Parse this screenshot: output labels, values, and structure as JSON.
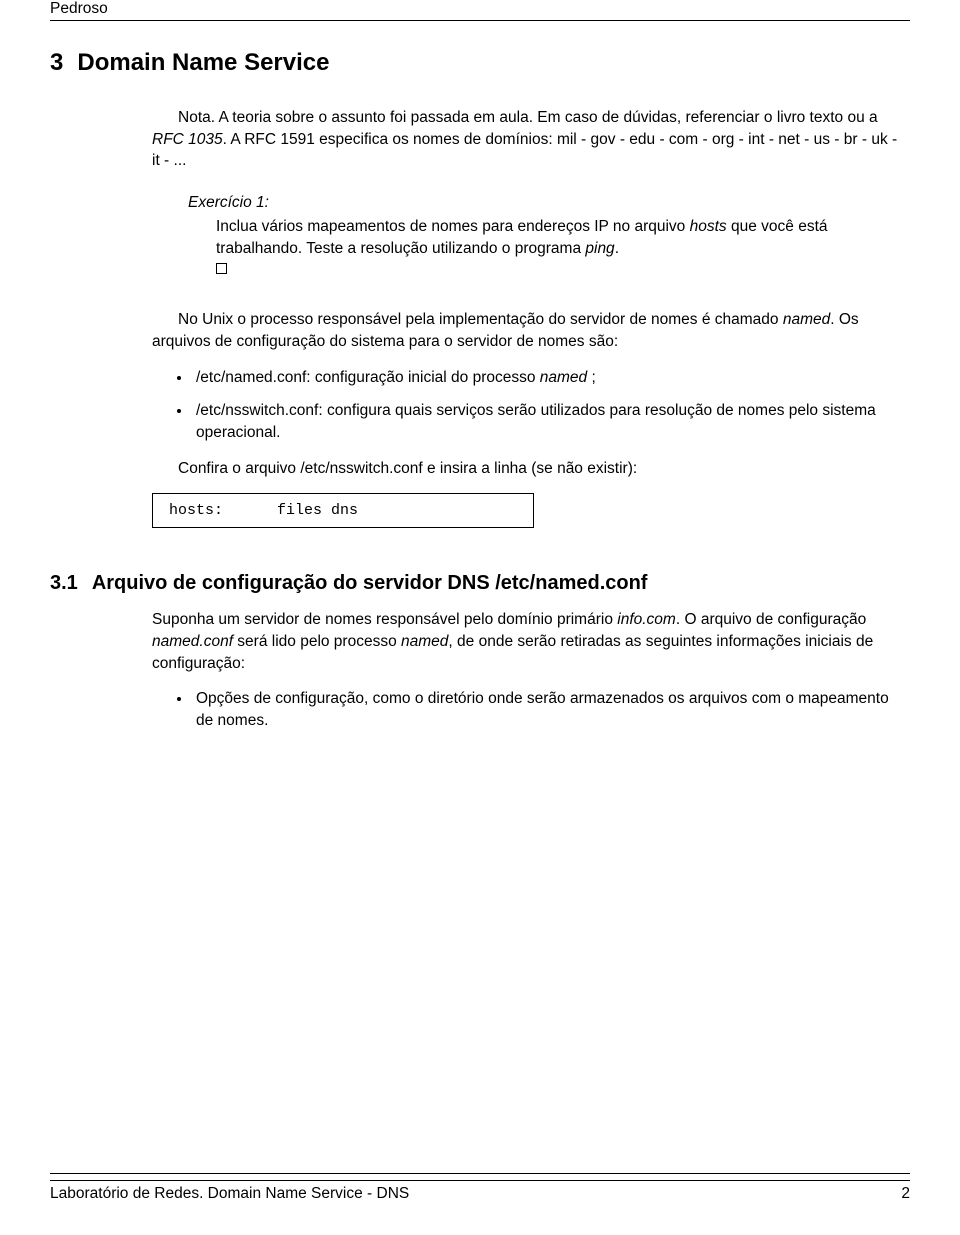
{
  "header": {
    "text": "Pedroso"
  },
  "section3": {
    "number": "3",
    "title": "Domain Name Service",
    "note_p1_a": "Nota. A teoria sobre o assunto foi passada em aula. Em caso de dúvidas, referenciar o livro texto ou a ",
    "note_p1_b": "RFC 1035",
    "note_p1_c": ". A RFC 1591 especifica os nomes de domínios: mil - gov - edu - com - org - int - net - us - br - uk - it - ...",
    "exercise_title": "Exercício 1:",
    "exercise_body_a": "Inclua vários mapeamentos de nomes para endereços IP no arquivo ",
    "exercise_body_b": "hosts",
    "exercise_body_c": " que você está trabalhando. Teste a resolução utilizando o programa ",
    "exercise_body_d": "ping",
    "exercise_body_e": ".",
    "p2_a": "No Unix o processo responsável pela implementação do servidor de nomes é chamado ",
    "p2_b": "named",
    "p2_c": ". Os arquivos de configuração do sistema para o servidor de nomes são:",
    "bul1_a": "/etc/named.conf: configuração inicial do processo ",
    "bul1_b": "named",
    "bul1_c": " ;",
    "bul2": "/etc/nsswitch.conf: configura quais serviços serão utilizados para resolução de nomes pelo sistema operacional.",
    "p3": "Confira o arquivo /etc/nsswitch.conf e insira a linha (se não existir):",
    "code": "hosts:      files dns"
  },
  "section31": {
    "number": "3.1",
    "title": "Arquivo de configuração do servidor DNS /etc/named.conf",
    "p1_a": "Suponha um servidor de nomes responsável pelo domínio primário ",
    "p1_b": "info.com",
    "p1_c": ". O arquivo de configuração ",
    "p1_d": "named.conf",
    "p1_e": " será lido pelo processo ",
    "p1_f": "named",
    "p1_g": ", de onde serão retiradas as seguintes informações iniciais de configuração:",
    "bul1": "Opções de configuração, como o diretório onde serão armazenados os arquivos com o mapeamento de nomes."
  },
  "footer": {
    "left": "Laboratório de Redes. Domain Name Service - DNS",
    "right": "2"
  }
}
